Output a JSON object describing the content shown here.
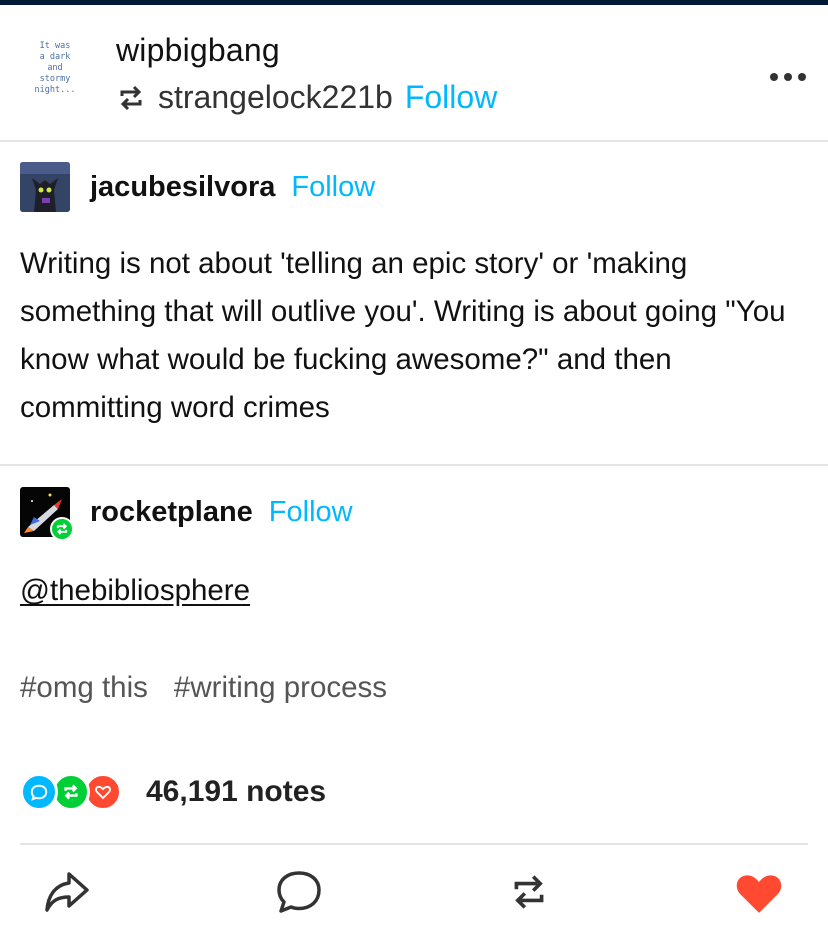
{
  "header": {
    "avatar_text": "It was\na dark\nand\nstormy\nnight...",
    "blog_name": "wipbigbang",
    "reblogged_from": "strangelock221b",
    "follow_label": "Follow"
  },
  "trail": [
    {
      "username": "jacubesilvora",
      "follow_label": "Follow",
      "text": "Writing is not about 'telling an epic story' or 'making something that will outlive you'. Writing is about going \"You know what would be fucking awesome?\" and then committing word crimes"
    },
    {
      "username": "rocketplane",
      "follow_label": "Follow",
      "mention": "@thebibliosphere"
    }
  ],
  "tags": [
    "#omg this",
    "#writing process"
  ],
  "notes": {
    "count_label": "46,191 notes"
  },
  "icons": {
    "reblog": "reblog-icon",
    "more": "more-options-icon",
    "share": "share-icon",
    "reply": "reply-icon",
    "like": "heart-icon"
  },
  "colors": {
    "follow": "#00b8ff",
    "reply_note": "#00b8ff",
    "reblog_note": "#00cf35",
    "like_note": "#ff4930",
    "heart": "#ff4930"
  }
}
